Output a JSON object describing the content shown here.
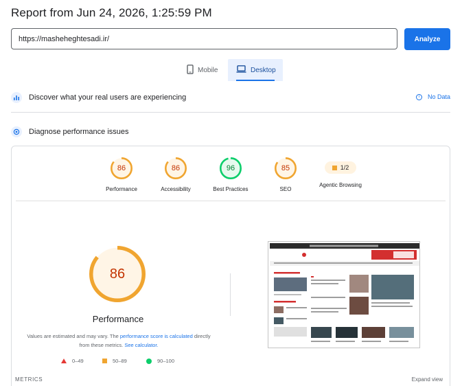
{
  "header": {
    "title": "Report from Jun 24, 2026, 1:25:59 PM"
  },
  "url_bar": {
    "value": "https://masheheghtesadi.ir/",
    "analyze_label": "Analyze"
  },
  "device_tabs": [
    {
      "label": "Mobile",
      "icon": "smartphone-icon",
      "selected": false
    },
    {
      "label": "Desktop",
      "icon": "laptop-icon",
      "selected": true
    }
  ],
  "discover": {
    "label": "Discover what your real users are experiencing",
    "icon": "users-chart-icon",
    "status": "No Data",
    "status_icon": "info-icon"
  },
  "diagnose": {
    "label": "Diagnose performance issues",
    "icon": "lighthouse-icon"
  },
  "categories": [
    {
      "label": "Performance",
      "score": "86",
      "score_value": 86,
      "color": "#f0a530",
      "text_color": "#c33300",
      "fill": "#fff5e6"
    },
    {
      "label": "Accessibility",
      "score": "86",
      "score_value": 86,
      "color": "#f0a530",
      "text_color": "#c33300",
      "fill": "#fff5e6"
    },
    {
      "label": "Best Practices",
      "score": "96",
      "score_value": 96,
      "color": "#0cce6b",
      "text_color": "#008033",
      "fill": "#e6f9ee"
    },
    {
      "label": "SEO",
      "score": "85",
      "score_value": 85,
      "color": "#f0a530",
      "text_color": "#c33300",
      "fill": "#fff5e6"
    },
    {
      "label": "Agentic Browsing",
      "score": "1/2",
      "color": "#f0a530"
    }
  ],
  "performance_detail": {
    "score": "86",
    "score_value": 86,
    "label": "Performance",
    "desc_prefix": "Values are estimated and may vary. The ",
    "desc_link1": "performance score is calculated",
    "desc_mid": " directly from these metrics. ",
    "desc_link2": "See calculator."
  },
  "legend": [
    {
      "range": "0–49",
      "color": "#e53935",
      "shape": "triangle"
    },
    {
      "range": "50–89",
      "color": "#f0a530",
      "shape": "square"
    },
    {
      "range": "90–100",
      "color": "#0cce6b",
      "shape": "circle"
    }
  ],
  "footer": {
    "metrics_label": "METRICS",
    "expand_label": "Expand view"
  },
  "colors": {
    "accent": "#1a73e8",
    "average": "#f0a530",
    "pass": "#0cce6b",
    "fail": "#e53935"
  }
}
